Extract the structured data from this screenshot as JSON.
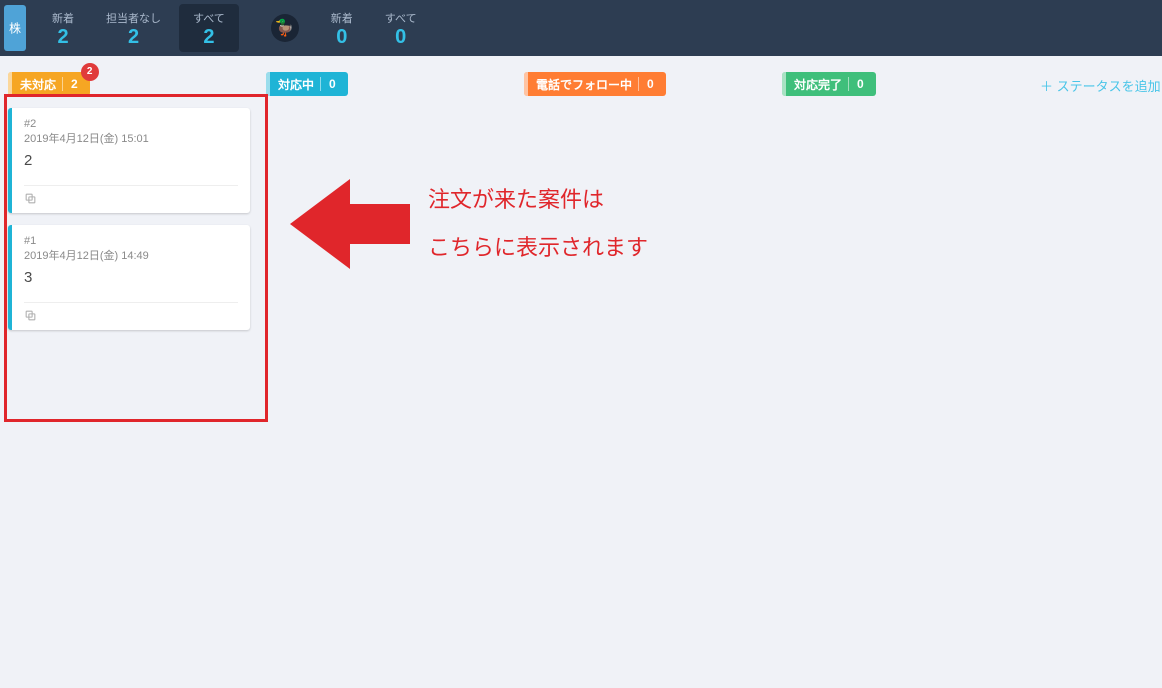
{
  "header": {
    "chip": "株",
    "groups": [
      {
        "items": [
          {
            "label": "新着",
            "count": "2",
            "active": false
          },
          {
            "label": "担当者なし",
            "count": "2",
            "active": false
          },
          {
            "label": "すべて",
            "count": "2",
            "active": true
          }
        ]
      },
      {
        "icon": "duck-icon",
        "items": [
          {
            "label": "新着",
            "count": "0",
            "active": false
          },
          {
            "label": "すべて",
            "count": "0",
            "active": false
          }
        ]
      }
    ]
  },
  "columns": [
    {
      "name": "未対応",
      "count": "2",
      "badge": "2",
      "color": "yellow"
    },
    {
      "name": "対応中",
      "count": "0",
      "color": "cyan"
    },
    {
      "name": "電話でフォロー中",
      "count": "0",
      "color": "orange"
    },
    {
      "name": "対応完了",
      "count": "0",
      "color": "green"
    }
  ],
  "cards": [
    {
      "id": "#2",
      "date": "2019年4月12日(金) 15:01",
      "title": "2"
    },
    {
      "id": "#1",
      "date": "2019年4月12日(金) 14:49",
      "title": "3"
    }
  ],
  "add_status_label": "＋ ステータスを追加",
  "annotation": {
    "line1": "注文が来た案件は",
    "line2": "こちらに表示されます"
  }
}
